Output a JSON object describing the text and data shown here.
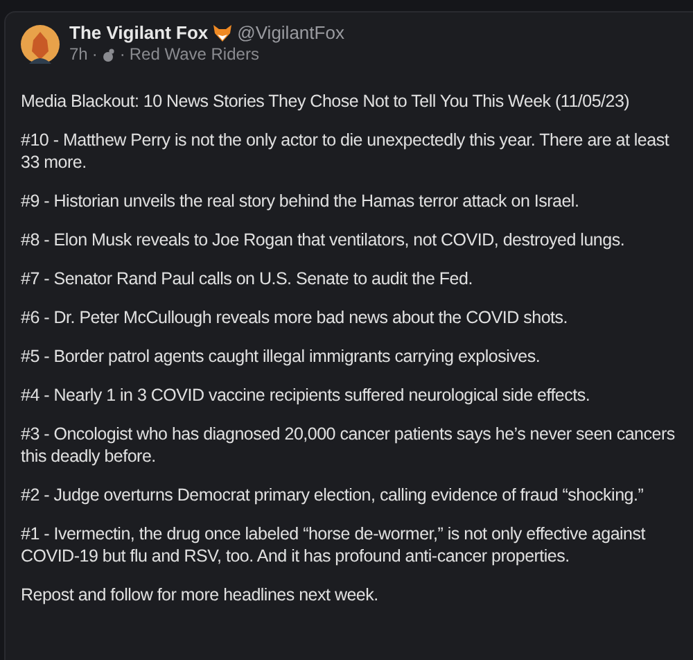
{
  "post": {
    "author": "The Vigilant Fox",
    "handle": "@VigilantFox",
    "time": "7h",
    "separator": "·",
    "community": "Red Wave Riders",
    "paragraphs": [
      "Media Blackout: 10 News Stories They Chose Not to Tell You This Week (11/05/23)",
      "#10 - Matthew Perry is not the only actor to die unexpectedly this year. There are at least 33 more.",
      "#9 - Historian unveils the real story behind the Hamas terror attack on Israel.",
      "#8 - Elon Musk reveals to Joe Rogan that ventilators, not COVID, destroyed lungs.",
      "#7 - Senator Rand Paul calls on U.S. Senate to audit the Fed.",
      "#6 - Dr. Peter McCullough reveals more bad news about the COVID shots.",
      "#5 - Border patrol agents caught illegal immigrants carrying explosives.",
      "#4 - Nearly 1 in 3 COVID vaccine recipients suffered neurological side effects.",
      "#3 - Oncologist who has diagnosed 20,000 cancer patients says he’s never seen cancers this deadly before.",
      "#2 - Judge overturns Democrat primary election, calling evidence of fraud “shocking.”",
      "#1 - Ivermectin, the drug once labeled “horse de-wormer,” is not only effective against COVID-19 but flu and RSV, too. And it has profound anti-cancer properties.",
      "Repost and follow for more headlines next week."
    ]
  }
}
